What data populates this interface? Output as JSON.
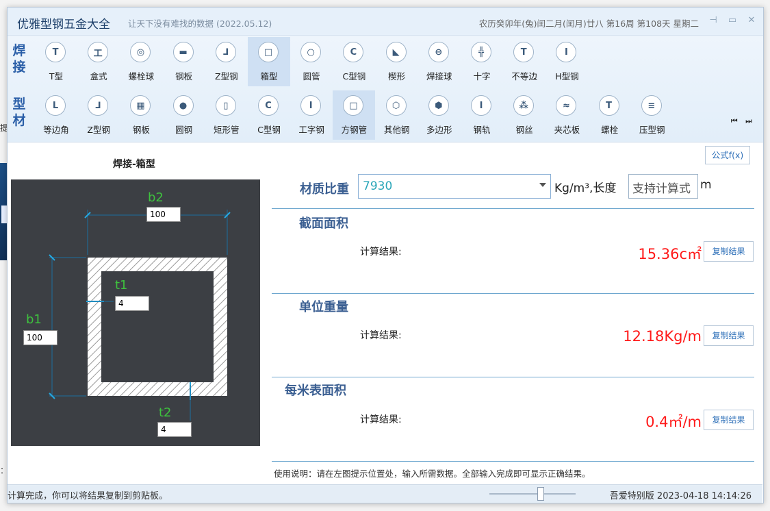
{
  "background": {
    "left_chars": [
      "提",
      "："
    ]
  },
  "titlebar": {
    "app_title": "优雅型钢五金大全",
    "subtitle": "让天下没有难找的数据 (2022.05.12)",
    "lunar_date": "农历癸卯年(兔)闰二月(闰月)廿八 第16周 第108天 星期二",
    "pin_icon": "pin-icon",
    "minimize_icon": "minimize-icon",
    "close_icon": "close-icon"
  },
  "toolbar": {
    "weld_label": "焊接",
    "profile_label": "型材",
    "weld_items": [
      {
        "label": "T型",
        "glyph": "T"
      },
      {
        "label": "盒式",
        "glyph": "工"
      },
      {
        "label": "螺栓球",
        "glyph": "◎"
      },
      {
        "label": "钢板",
        "glyph": "▬"
      },
      {
        "label": "Z型钢",
        "glyph": "⅃"
      },
      {
        "label": "箱型",
        "glyph": "□"
      },
      {
        "label": "圆管",
        "glyph": "○"
      },
      {
        "label": "C型钢",
        "glyph": "C"
      },
      {
        "label": "楔形",
        "glyph": "◣"
      },
      {
        "label": "焊接球",
        "glyph": "⊖"
      },
      {
        "label": "十字",
        "glyph": "╬"
      },
      {
        "label": "不等边",
        "glyph": "T"
      },
      {
        "label": "H型钢",
        "glyph": "I"
      }
    ],
    "profile_items": [
      {
        "label": "等边角",
        "glyph": "L"
      },
      {
        "label": "Z型钢",
        "glyph": "⅃"
      },
      {
        "label": "钢板",
        "glyph": "▦"
      },
      {
        "label": "圆钢",
        "glyph": "●"
      },
      {
        "label": "矩形管",
        "glyph": "▯"
      },
      {
        "label": "C型钢",
        "glyph": "C"
      },
      {
        "label": "工字钢",
        "glyph": "I"
      },
      {
        "label": "方钢管",
        "glyph": "□"
      },
      {
        "label": "其他钢",
        "glyph": "⬡"
      },
      {
        "label": "多边形",
        "glyph": "⬢"
      },
      {
        "label": "钢轨",
        "glyph": "I"
      },
      {
        "label": "钢丝",
        "glyph": "⁂"
      },
      {
        "label": "夹芯板",
        "glyph": "≈"
      },
      {
        "label": "螺栓",
        "glyph": "T"
      },
      {
        "label": "压型钢",
        "glyph": "≡"
      }
    ],
    "nav_arrows": "⏮ ⏭"
  },
  "drawing": {
    "title": "焊接-箱型",
    "b2_label": "b2",
    "b2_value": "100",
    "b1_label": "b1",
    "b1_value": "100",
    "t1_label": "t1",
    "t1_value": "4",
    "t2_label": "t2",
    "t2_value": "4"
  },
  "calc": {
    "formula_button": "公式f(x)",
    "density_label": "材质比重",
    "density_value": "7930",
    "density_unit": "Kg/m³,长度",
    "length_placeholder": "支持计算式",
    "length_unit": "m",
    "result_label": "计算结果:",
    "copy_label": "复制结果",
    "sections": [
      {
        "title": "截面面积",
        "value": "15.36c㎡"
      },
      {
        "title": "单位重量",
        "value": "12.18Kg/m"
      },
      {
        "title": "每米表面积",
        "value": "0.4㎡/m"
      }
    ],
    "usage": "使用说明：请在左图提示位置处，输入所需数据。全部输入完成即可显示正确结果。"
  },
  "statusbar": {
    "left": "计算完成，你可以将结果复制到剪贴板。",
    "right": "吾爱特别版  2023-04-18 14:14:26"
  },
  "colors": {
    "accent": "#3b5f92",
    "result": "#ff1a1a",
    "dim_green": "#3ec23e",
    "drawing_bg": "#3c3f44"
  }
}
